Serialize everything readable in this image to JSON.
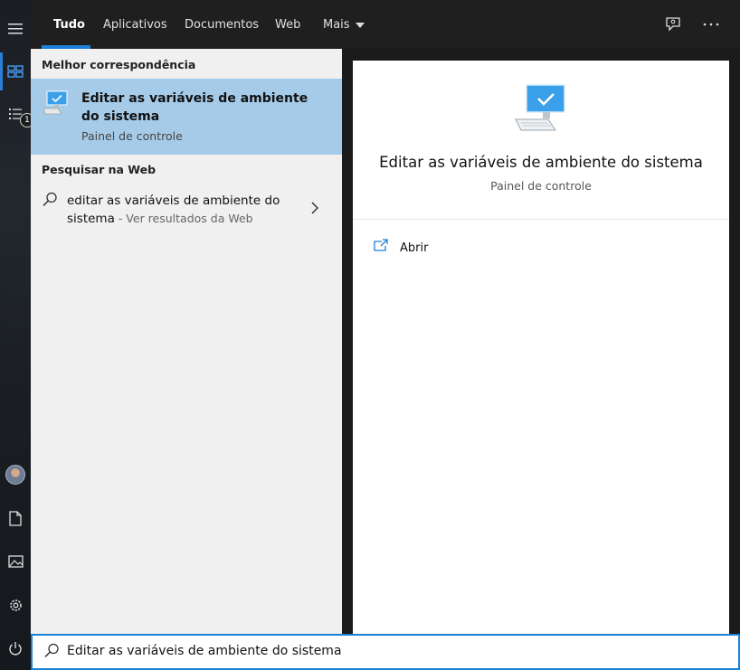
{
  "rail": {
    "items": [
      {
        "name": "hamburger-menu-icon"
      },
      {
        "name": "home-grid-icon"
      },
      {
        "name": "documents-list-icon",
        "badge": "1"
      },
      {
        "name": "avatar"
      },
      {
        "name": "document-icon"
      },
      {
        "name": "pictures-icon"
      },
      {
        "name": "gear-icon"
      },
      {
        "name": "power-icon"
      }
    ]
  },
  "tabs": [
    {
      "label": "Tudo",
      "active": true
    },
    {
      "label": "Aplicativos"
    },
    {
      "label": "Documentos"
    },
    {
      "label": "Web"
    },
    {
      "label": "Mais",
      "has_dropdown": true
    }
  ],
  "top_icons": [
    "feedback-icon",
    "more-options-icon"
  ],
  "best_match": {
    "section_title": "Melhor correspondência",
    "title": "Editar as variáveis de ambiente do sistema",
    "subtitle": "Painel de controle",
    "icon": "system-monitor-icon"
  },
  "web_search": {
    "section_title": "Pesquisar na Web",
    "query": "editar as variáveis de ambiente do sistema",
    "suffix": " - Ver resultados da Web"
  },
  "preview": {
    "title": "Editar as variáveis de ambiente do sistema",
    "subtitle": "Painel de controle",
    "actions": [
      {
        "label": "Abrir",
        "icon": "open-icon"
      }
    ]
  },
  "search": {
    "value": "Editar as variáveis de ambiente do sistema"
  },
  "colors": {
    "accent": "#1a80d8",
    "selection": "#a6cbe8",
    "topbar": "#1f1f1f"
  }
}
